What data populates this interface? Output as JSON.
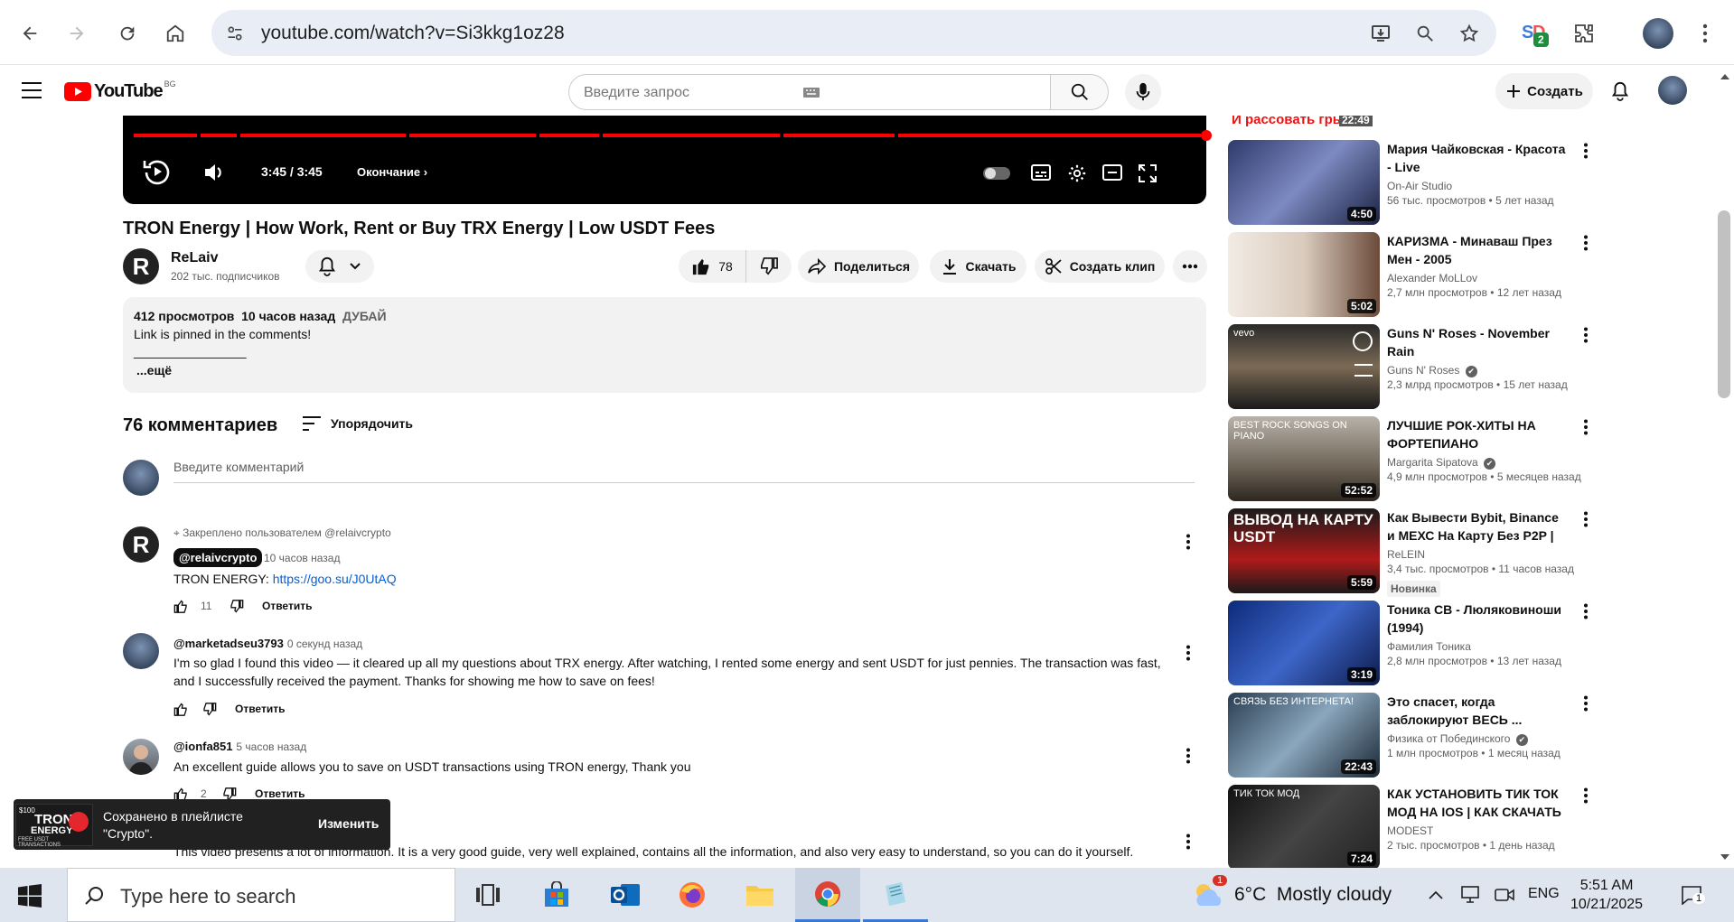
{
  "browser": {
    "url": "youtube.com/watch?v=Si3kkg1oz28",
    "extension_badge": "2"
  },
  "youtube": {
    "logo_text": "YouTube",
    "region": "BG",
    "search_placeholder": "Введите запрос",
    "create_label": "Создать"
  },
  "player": {
    "time": "3:45 / 3:45",
    "chapter": "Окончание"
  },
  "video": {
    "title": "TRON Energy | How Work, Rent or Buy TRX Energy | Low USDT Fees",
    "channel": "ReLaiv",
    "channel_initial": "R",
    "subscribers": "202 тыс. подписчиков",
    "likes": "78",
    "share_label": "Поделиться",
    "download_label": "Скачать",
    "clip_label": "Создать клип"
  },
  "description": {
    "views": "412 просмотров",
    "time": "10 часов назад",
    "tag": "ДУБАЙ",
    "line1": "Link is pinned in the comments!",
    "line2": "________________",
    "more": "...ещё"
  },
  "comments": {
    "count_label": "76 комментариев",
    "sort_label": "Упорядочить",
    "input_placeholder": "Введите комментарий",
    "pinned_label": "Закреплено пользователем @relaivcrypto",
    "reply_label": "Ответить",
    "items": [
      {
        "author": "@relaivcrypto",
        "time": "10 часов назад",
        "text_prefix": "TRON ENERGY: ",
        "link": "https://goo.su/J0UtAQ",
        "likes": "11"
      },
      {
        "author": "@marketadseu3793",
        "time": "0 секунд назад",
        "text": "I'm so glad I found this video — it cleared up all my questions about TRX energy. After watching, I rented some energy and sent USDT for just pennies. The transaction was fast, and I successfully received the payment. Thanks for showing me how to save on fees!",
        "likes": ""
      },
      {
        "author": "@ionfa851",
        "time": "5 часов назад",
        "text": "An excellent guide allows you to save on USDT transactions using TRON energy, Thank you",
        "likes": "2"
      },
      {
        "author": "",
        "time": "",
        "text": "This video presents a lot of information. It is a very good guide, very well explained, contains all the information, and also very easy to understand, so you can do it yourself.",
        "likes": ""
      }
    ]
  },
  "toast": {
    "message_line1": "Сохранено в плейлисте",
    "message_line2": "\"Crypto\".",
    "action": "Изменить",
    "thumb_text1": "$100",
    "thumb_text2": "TRON",
    "thumb_text3": "ENERGY",
    "thumb_text4": "FREE USDT TRANSACTIONS"
  },
  "sidebar": {
    "partial_top_text": "И рассовать грыжи",
    "partial_top_duration": "22:49",
    "items": [
      {
        "title": "Мария Чайковская - Красота - Live",
        "channel": "On-Air Studio",
        "meta": "56 тыс. просмотров • 5 лет назад",
        "duration": "4:50",
        "verified": false,
        "badge": ""
      },
      {
        "title": "КАРИЗМА - Минаваш През Мен - 2005",
        "channel": "Alexander MoLLov",
        "meta": "2,7 млн просмотров • 12 лет назад",
        "duration": "5:02",
        "verified": false,
        "badge": ""
      },
      {
        "title": "Guns N' Roses - November Rain",
        "channel": "Guns N' Roses",
        "meta": "2,3 млрд просмотров • 15 лет назад",
        "duration": "",
        "verified": true,
        "badge": "",
        "thumb_text": "vevo"
      },
      {
        "title": "ЛУЧШИЕ РОК-ХИТЫ НА ФОРТЕПИАНО",
        "channel": "Margarita Sipatova",
        "meta": "4,9 млн просмотров • 5 месяцев назад",
        "duration": "52:52",
        "verified": true,
        "badge": "",
        "thumb_text": "BEST ROCK SONGS ON PIANO"
      },
      {
        "title": "Как Вывести Bybit, Binance и МЕХС На Карту Без P2P | ...",
        "channel": "ReLEIN",
        "meta": "3,4 тыс. просмотров • 11 часов назад",
        "duration": "5:59",
        "verified": false,
        "badge": "Новинка",
        "thumb_text": "ВЫВОД НА КАРТУ USDT"
      },
      {
        "title": "Тоника СВ - Люляковиноши (1994)",
        "channel": "Фамилия Тоника",
        "meta": "2,8 млн просмотров • 13 лет назад",
        "duration": "3:19",
        "verified": false,
        "badge": ""
      },
      {
        "title": "Это спасет, когда заблокируют ВЕСЬ ...",
        "channel": "Физика от Побединского",
        "meta": "1 млн просмотров • 1 месяц назад",
        "duration": "22:43",
        "verified": true,
        "badge": "",
        "thumb_text": "СВЯЗЬ БЕЗ ИНТЕРНЕТА!"
      },
      {
        "title": "КАК УСТАНОВИТЬ ТИК ТОК МОД НА IOS | КАК СКАЧАТЬ ...",
        "channel": "MODEST",
        "meta": "2 тыс. просмотров • 1 день назад",
        "duration": "7:24",
        "verified": false,
        "badge": "",
        "thumb_text": "ТИК ТОК МОД"
      }
    ]
  },
  "taskbar": {
    "search_placeholder": "Type here to search",
    "weather": "6°C  Mostly cloudy",
    "weather_badge": "1",
    "lang": "ENG",
    "time": "5:51 AM",
    "date": "10/21/2025",
    "notif_count": "1"
  },
  "colors": {
    "accent_red": "#ff0000",
    "link_blue": "#065fd4"
  }
}
